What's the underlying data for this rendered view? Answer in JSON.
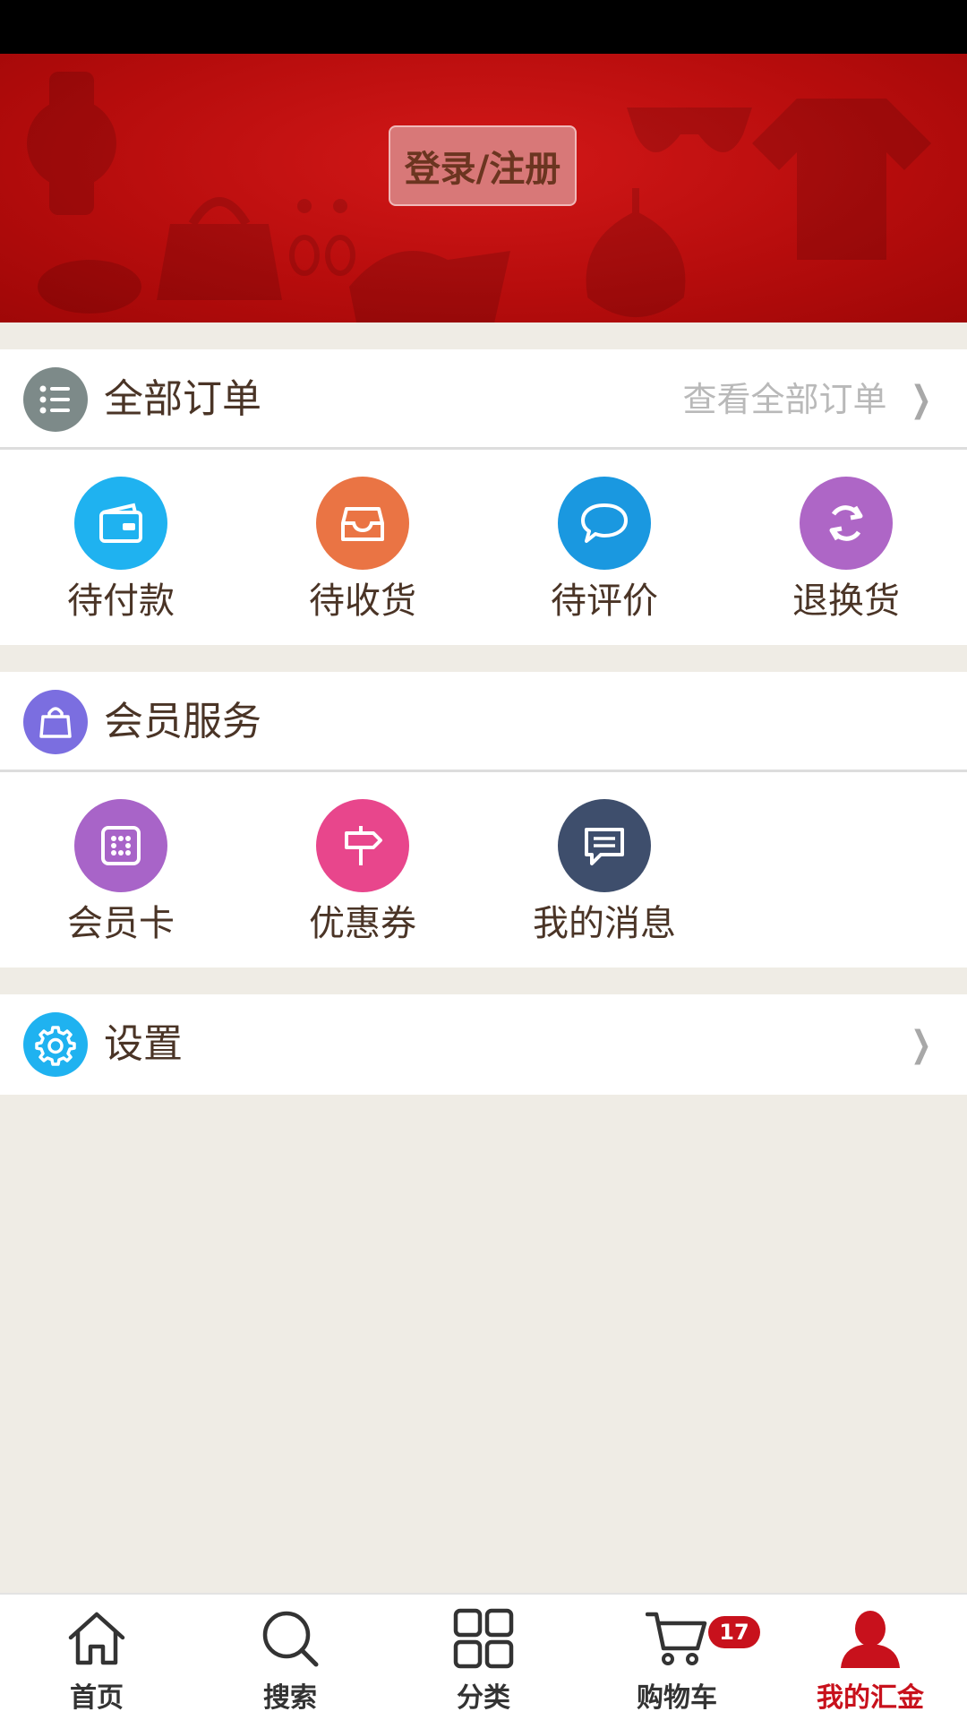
{
  "banner": {
    "login_label": "登录/注册"
  },
  "orders": {
    "title": "全部订单",
    "view_all": "查看全部订单",
    "items": [
      {
        "label": "待付款",
        "icon": "wallet-icon",
        "color": "#1fb2f0"
      },
      {
        "label": "待收货",
        "icon": "inbox-icon",
        "color": "#ea7444"
      },
      {
        "label": "待评价",
        "icon": "chat-bubble-icon",
        "color": "#1a98e0"
      },
      {
        "label": "退换货",
        "icon": "refresh-icon",
        "color": "#ae66c6"
      }
    ]
  },
  "member": {
    "title": "会员服务",
    "items": [
      {
        "label": "会员卡",
        "icon": "member-card-icon",
        "color": "#a864c8"
      },
      {
        "label": "优惠券",
        "icon": "signpost-icon",
        "color": "#e8468c"
      },
      {
        "label": "我的消息",
        "icon": "message-icon",
        "color": "#3e4e6c"
      }
    ]
  },
  "settings": {
    "title": "设置"
  },
  "tabbar": {
    "items": [
      {
        "label": "首页",
        "icon": "home-icon"
      },
      {
        "label": "搜索",
        "icon": "search-icon"
      },
      {
        "label": "分类",
        "icon": "grid-icon"
      },
      {
        "label": "购物车",
        "icon": "cart-icon",
        "badge": "17"
      },
      {
        "label": "我的汇金",
        "icon": "user-icon",
        "active": true
      }
    ],
    "active_color": "#c8111c"
  }
}
